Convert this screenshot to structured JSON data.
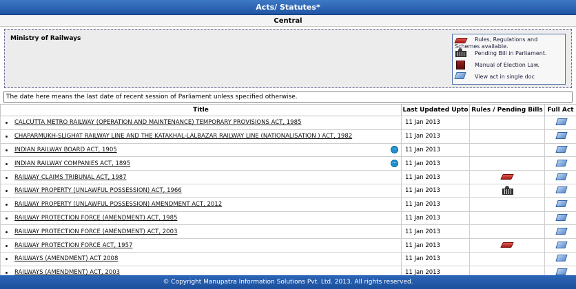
{
  "page": {
    "title": "Acts/ Statutes*",
    "subtitle": "Central",
    "ministry": "Ministry of Railways",
    "note": "The date here means the last date of recent session of Parliament unless specified otherwise.",
    "footer": "© Copyright Manupatra Information Solutions Pvt. Ltd. 2013. All rights reserved."
  },
  "legend": {
    "rules_line1": "Rules, Regulations and",
    "rules_line2": "Schemes available.",
    "pending": "Pending Bill in Parliament.",
    "manual": "Manual of Election Law.",
    "single_doc": "View act in single doc",
    "icons": [
      "rules-book-icon",
      "parliament-icon",
      "manual-book-icon",
      "document-icon"
    ]
  },
  "table": {
    "headers": {
      "title": "Title",
      "last_updated": "Last Updated Upto",
      "rules_pending": "Rules / Pending Bills",
      "full_act": "Full Act"
    },
    "rows": [
      {
        "title": "CALCUTTA METRO RAILWAY (OPERATION AND MAINTENANCE) TEMPORARY PROVISIONS ACT, 1985",
        "date": "11 Jan 2013",
        "status": "none",
        "info": false
      },
      {
        "title": "CHAPARMUKH-SLIGHAT RAILWAY LINE AND THE KATAKHAL-LALBAZAR RAILWAY LINE (NATIONALISATION ) ACT, 1982",
        "date": "11 Jan 2013",
        "status": "none",
        "info": false
      },
      {
        "title": "INDIAN RAILWAY BOARD ACT, 1905",
        "date": "11 Jan 2013",
        "status": "none",
        "info": true
      },
      {
        "title": "INDIAN RAILWAY COMPANIES ACT, 1895",
        "date": "11 Jan 2013",
        "status": "none",
        "info": true
      },
      {
        "title": "RAILWAY CLAIMS TRIBUNAL ACT, 1987",
        "date": "11 Jan 2013",
        "status": "rules",
        "info": false
      },
      {
        "title": "RAILWAY PROPERTY (UNLAWFUL POSSESSION) ACT, 1966",
        "date": "11 Jan 2013",
        "status": "pending",
        "info": false
      },
      {
        "title": "RAILWAY PROPERTY (UNLAWFUL POSSESSION) AMENDMENT ACT, 2012",
        "date": "11 Jan 2013",
        "status": "none",
        "info": false
      },
      {
        "title": "RAILWAY PROTECTION FORCE (AMENDMENT) ACT, 1985",
        "date": "11 Jan 2013",
        "status": "none",
        "info": false
      },
      {
        "title": "RAILWAY PROTECTION FORCE (AMENDMENT) ACT, 2003",
        "date": "11 Jan 2013",
        "status": "none",
        "info": false
      },
      {
        "title": "RAILWAY PROTECTION FORCE ACT, 1957",
        "date": "11 Jan 2013",
        "status": "rules",
        "info": false
      },
      {
        "title": "RAILWAYS (AMENDMENT) ACT 2008",
        "date": "11 Jan 2013",
        "status": "none",
        "info": false
      },
      {
        "title": "RAILWAYS (AMENDMENT) ACT, 2003",
        "date": "11 Jan 2013",
        "status": "none",
        "info": false
      }
    ]
  },
  "colors": {
    "header_blue": "#2a62b2",
    "footer_blue": "#2059a8",
    "panel_gray": "#ececec"
  }
}
